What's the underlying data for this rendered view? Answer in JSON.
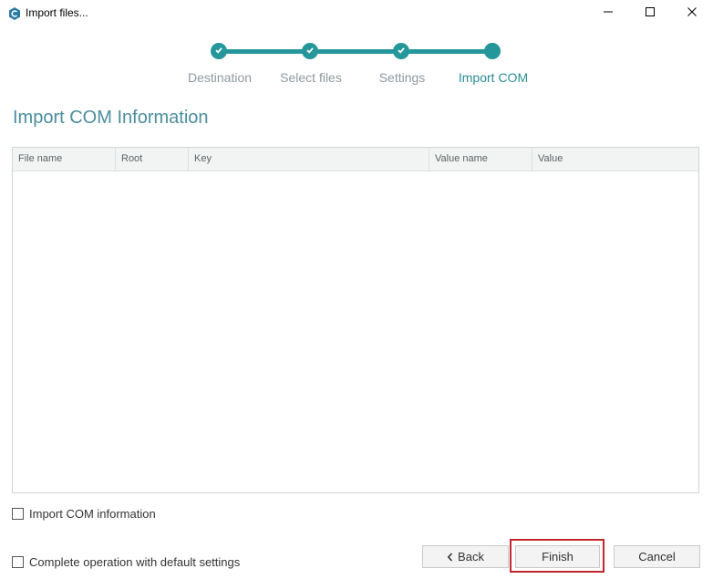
{
  "window": {
    "title": "Import files..."
  },
  "stepper": {
    "steps": [
      {
        "label": "Destination",
        "state": "done"
      },
      {
        "label": "Select files",
        "state": "done"
      },
      {
        "label": "Settings",
        "state": "done"
      },
      {
        "label": "Import COM",
        "state": "current"
      }
    ]
  },
  "page": {
    "title": "Import COM Information"
  },
  "table": {
    "columns": [
      "File name",
      "Root",
      "Key",
      "Value name",
      "Value"
    ],
    "rows": []
  },
  "options": {
    "import_com_label": "Import COM information",
    "default_settings_label": "Complete operation with default settings"
  },
  "buttons": {
    "back": "Back",
    "finish": "Finish",
    "cancel": "Cancel"
  },
  "colors": {
    "accent": "#25979b",
    "highlight": "#c1272d"
  }
}
